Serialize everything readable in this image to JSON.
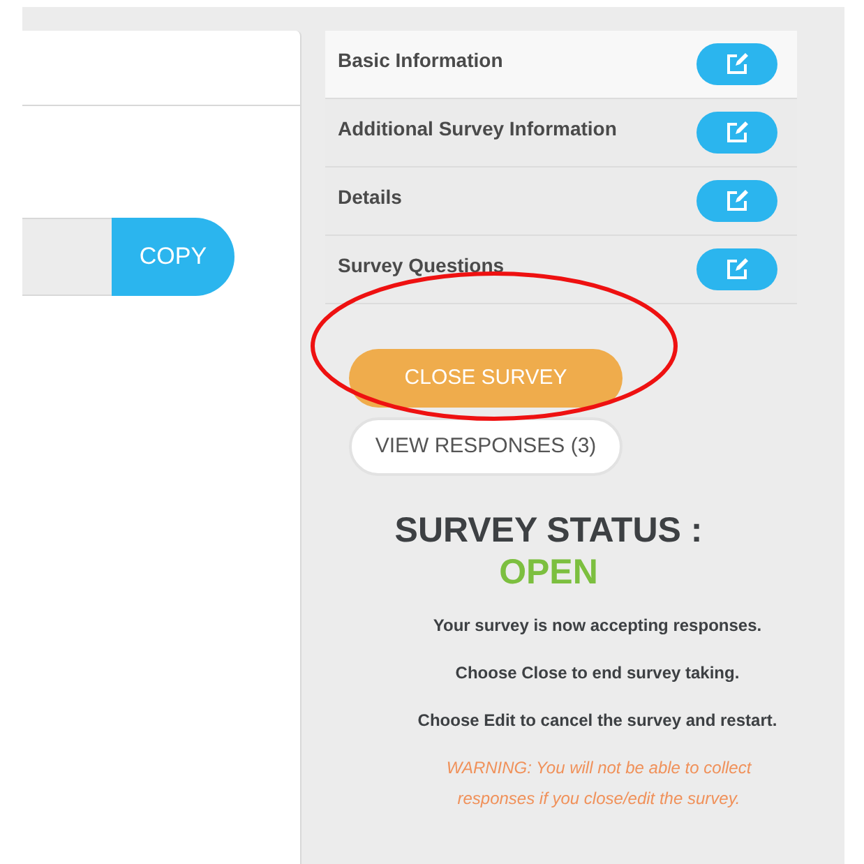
{
  "link_box": {
    "button": "COPY"
  },
  "sections": [
    {
      "label": "Basic Information",
      "selected": true
    },
    {
      "label": "Additional Survey Information",
      "selected": false
    },
    {
      "label": "Details",
      "selected": false
    },
    {
      "label": "Survey Questions",
      "selected": false
    }
  ],
  "actions": [
    {
      "label": "CLOSE SURVEY",
      "kind": "primary"
    },
    {
      "label": "VIEW RESPONSES (3)",
      "kind": "outline"
    }
  ],
  "status": {
    "heading": "SURVEY STATUS :",
    "value": "OPEN"
  },
  "notes": [
    "Your survey is now accepting responses.",
    "Choose Close to end survey taking.",
    "Choose Edit to cancel the survey and restart."
  ],
  "warning": "WARNING: You will not be able to collect responses if you close/edit the survey."
}
